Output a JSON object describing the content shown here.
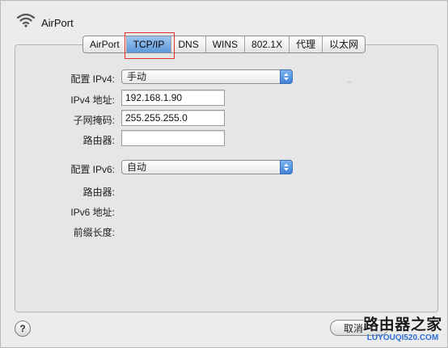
{
  "window": {
    "title": "AirPort"
  },
  "tabs": [
    {
      "label": "AirPort",
      "active": false
    },
    {
      "label": "TCP/IP",
      "active": true
    },
    {
      "label": "DNS",
      "active": false
    },
    {
      "label": "WINS",
      "active": false
    },
    {
      "label": "802.1X",
      "active": false
    },
    {
      "label": "代理",
      "active": false
    },
    {
      "label": "以太网",
      "active": false
    }
  ],
  "ipv4": {
    "config_label": "配置 IPv4:",
    "config_value": "手动",
    "address_label": "IPv4 地址:",
    "address_value": "192.168.1.90",
    "subnet_label": "子网掩码:",
    "subnet_value": "255.255.255.0",
    "router_label": "路由器:",
    "router_value": ""
  },
  "ipv6": {
    "config_label": "配置 IPv6:",
    "config_value": "自动",
    "router_label": "路由器:",
    "address_label": "IPv6 地址:",
    "prefix_label": "前缀长度:"
  },
  "footer": {
    "help_label": "?",
    "cancel_label": "取消"
  },
  "watermark": {
    "main": "路由器之家",
    "sub": "LUYOUQI520.COM"
  },
  "colors": {
    "active_tab": "#5d98db",
    "highlight_box": "#e03030",
    "stepper": "#3f82d6"
  }
}
